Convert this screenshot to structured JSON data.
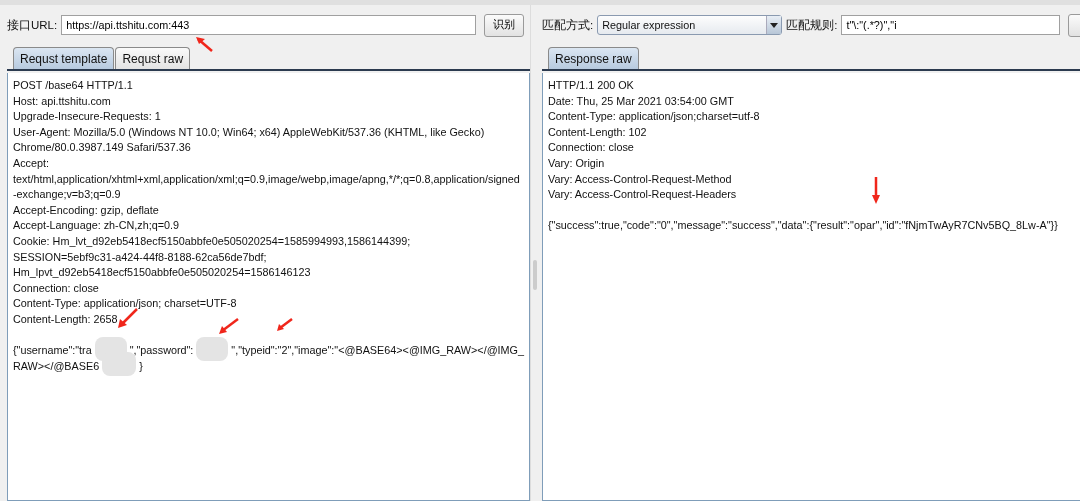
{
  "request_panel": {
    "url_label": "接口URL:",
    "url_value": "https://api.ttshitu.com:443",
    "recognize_button": "识别",
    "tabs": [
      {
        "label": "Requst template",
        "selected": true
      },
      {
        "label": "Requst raw",
        "selected": false
      }
    ],
    "lines": [
      "POST /base64 HTTP/1.1",
      "Host: api.ttshitu.com",
      "Upgrade-Insecure-Requests: 1",
      "User-Agent: Mozilla/5.0 (Windows NT 10.0; Win64; x64) AppleWebKit/537.36 (KHTML, like Gecko)",
      "Chrome/80.0.3987.149 Safari/537.36",
      "Accept:",
      "text/html,application/xhtml+xml,application/xml;q=0.9,image/webp,image/apng,*/*;q=0.8,application/signed",
      "-exchange;v=b3;q=0.9",
      "Accept-Encoding: gzip, deflate",
      "Accept-Language: zh-CN,zh;q=0.9",
      "Cookie: Hm_lvt_d92eb5418ecf5150abbfe0e505020254=1585994993,1586144399;",
      "SESSION=5ebf9c31-a424-44f8-8188-62ca56de7bdf;",
      "Hm_lpvt_d92eb5418ecf5150abbfe0e505020254=1586146123",
      "Connection: close",
      "Content-Type: application/json; charset=UTF-8",
      "Content-Length: 2658"
    ],
    "body_lines": [
      [
        {
          "kind": "text",
          "text": "{\"username\":\"tra"
        },
        {
          "kind": "blur"
        },
        {
          "kind": "text",
          "text": "\",\"password\":"
        },
        {
          "kind": "blur"
        },
        {
          "kind": "text",
          "text": "\",\"typeid\":\"2\",\"image\":\"<@BASE64><@IMG_RAW></@IMG_"
        }
      ],
      [
        {
          "kind": "text",
          "text": "RAW></@BASE6"
        },
        {
          "kind": "blur"
        },
        {
          "kind": "text",
          "text": "}"
        }
      ]
    ]
  },
  "response_panel": {
    "match_mode_label": "匹配方式:",
    "match_mode_value": "Regular expression",
    "match_rule_label": "匹配规则:",
    "match_rule_value": "t\"\\:\"(.*?)\",\"i",
    "tabs": [
      {
        "label": "Response raw",
        "selected": true
      }
    ],
    "lines": [
      "HTTP/1.1 200 OK",
      "Date: Thu, 25 Mar 2021 03:54:00 GMT",
      "Content-Type: application/json;charset=utf-8",
      "Content-Length: 102",
      "Connection: close",
      "Vary: Origin",
      "Vary: Access-Control-Request-Method",
      "Vary: Access-Control-Request-Headers"
    ],
    "body": "{\"success\":true,\"code\":\"0\",\"message\":\"success\",\"data\":{\"result\":\"opar\",\"id\":\"fNjmTwAyR7CNv5BQ_8Lw-A\"}}"
  }
}
